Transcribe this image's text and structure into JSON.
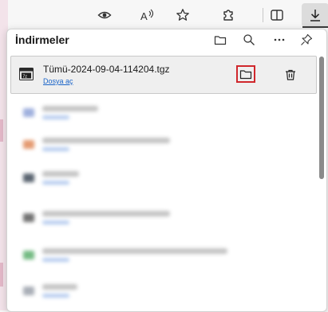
{
  "toolbar": {
    "icons": [
      "eye-icon",
      "read-aloud-icon",
      "favorite-star-icon",
      "extensions-puzzle-icon",
      "split-screen-icon",
      "downloads-icon"
    ]
  },
  "panel": {
    "title": "İndirmeler",
    "header_icons": [
      "open-folder-icon",
      "search-icon",
      "more-icon",
      "pin-icon"
    ]
  },
  "downloads": {
    "first": {
      "filename": "Tümü-2024-09-04-114204.tgz",
      "action_link": "Dosya aç",
      "file_icon": "archive-file-icon"
    },
    "blurred_colors": [
      "#8fa3d8",
      "#e08a5a",
      "#3e4a58",
      "#5a5a5a",
      "#5caf6e",
      "#9aa0aa"
    ]
  },
  "colors": {
    "highlight_border": "#d0272c",
    "link": "#1a64c8"
  }
}
